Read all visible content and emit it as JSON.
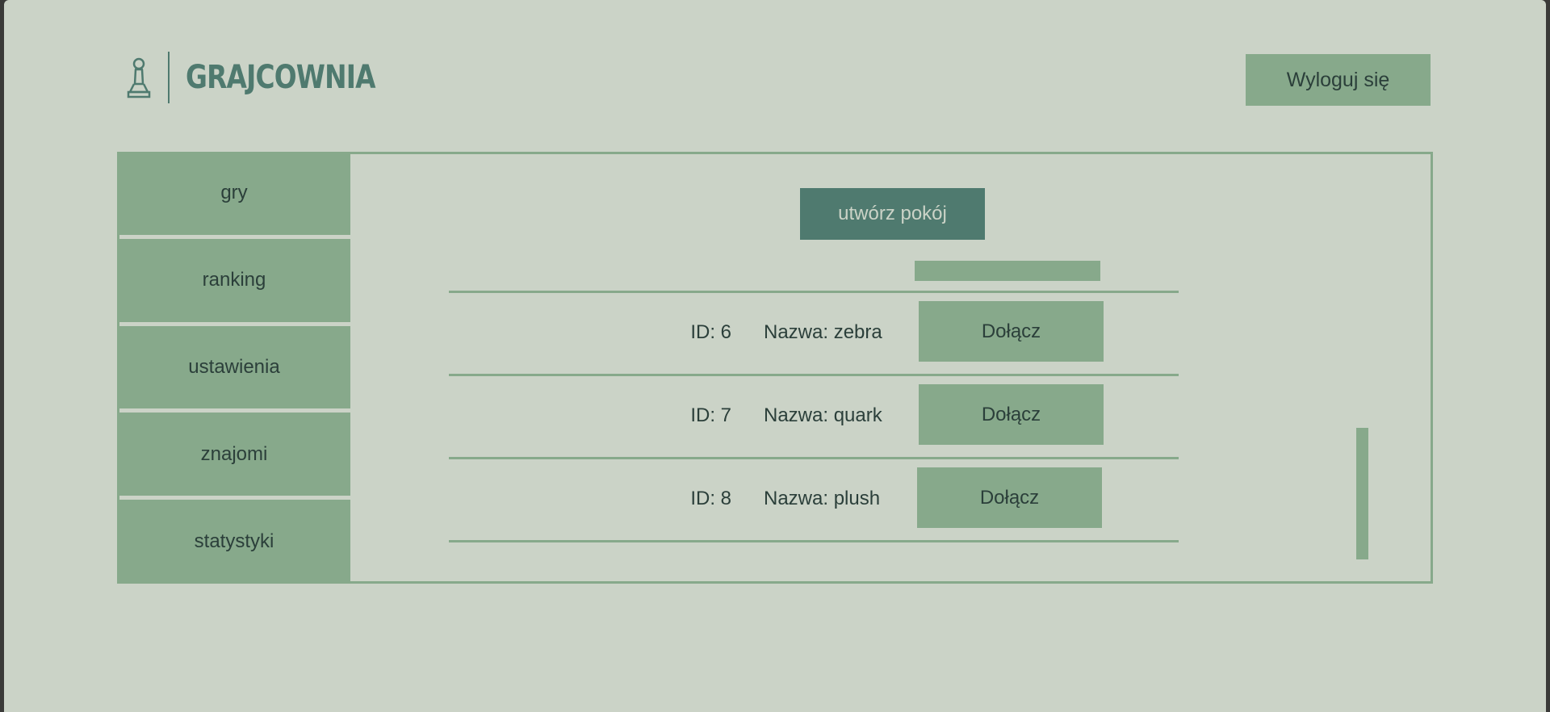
{
  "header": {
    "logo_text": "GRAJCOWNIA",
    "logout_label": "Wyloguj się"
  },
  "sidebar": {
    "items": [
      {
        "label": "gry"
      },
      {
        "label": "ranking"
      },
      {
        "label": "ustawienia"
      },
      {
        "label": "znajomi"
      },
      {
        "label": "statystyki"
      }
    ]
  },
  "main": {
    "create_room_label": "utwórz pokój",
    "rooms": [
      {
        "id": "ID: 6",
        "name": "Nazwa: zebra",
        "join_label": "Dołącz"
      },
      {
        "id": "ID: 7",
        "name": "Nazwa: quark",
        "join_label": "Dołącz"
      },
      {
        "id": "ID: 8",
        "name": "Nazwa: plush",
        "join_label": "Dołącz"
      }
    ]
  },
  "colors": {
    "background": "#cbd3c7",
    "accent": "#87a98b",
    "accent_dark": "#4f7a6f",
    "text": "#2b3f3a"
  },
  "icons": {
    "logo_icon": "pawn-icon"
  }
}
